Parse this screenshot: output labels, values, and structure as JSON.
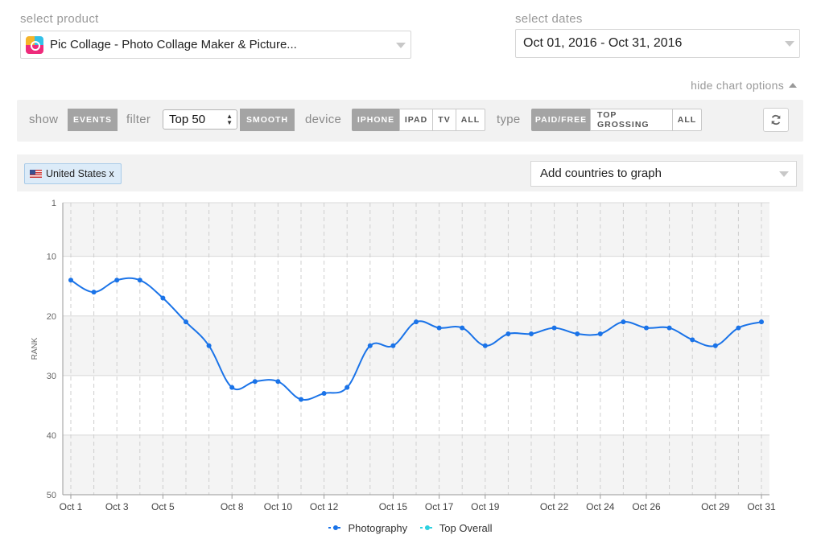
{
  "product": {
    "label": "select product",
    "selected": "Pic Collage - Photo Collage Maker & Picture..."
  },
  "dates": {
    "label": "select dates",
    "selected": "Oct 01, 2016 - Oct 31, 2016"
  },
  "chart_options": {
    "toggle": "hide chart options"
  },
  "options": {
    "show_label": "show",
    "events": "EVENTS",
    "filter_label": "filter",
    "filter_value": "Top 50",
    "smooth": "SMOOTH",
    "device_label": "device",
    "devices": [
      "IPHONE",
      "IPAD",
      "TV",
      "ALL"
    ],
    "type_label": "type",
    "types": [
      "PAID/FREE",
      "TOP GROSSING",
      "ALL"
    ]
  },
  "countries": {
    "selected_chip": "United States x",
    "add_placeholder": "Add countries to graph"
  },
  "colors": {
    "accent": "#1a73e8",
    "top_overall": "#2ed1e0",
    "button_active": "#a4a4a4"
  },
  "chart_data": {
    "type": "line",
    "ylabel": "RANK",
    "xlabel": "",
    "title": "",
    "y_inverted": true,
    "ylim": [
      1,
      50
    ],
    "y_ticks": [
      1,
      10,
      20,
      30,
      40,
      50
    ],
    "x_days": 31,
    "x_tick_labels": [
      {
        "day": 1,
        "label": "Oct 1"
      },
      {
        "day": 3,
        "label": "Oct 3"
      },
      {
        "day": 5,
        "label": "Oct 5"
      },
      {
        "day": 8,
        "label": "Oct 8"
      },
      {
        "day": 10,
        "label": "Oct 10"
      },
      {
        "day": 12,
        "label": "Oct 12"
      },
      {
        "day": 15,
        "label": "Oct 15"
      },
      {
        "day": 17,
        "label": "Oct 17"
      },
      {
        "day": 19,
        "label": "Oct 19"
      },
      {
        "day": 22,
        "label": "Oct 22"
      },
      {
        "day": 24,
        "label": "Oct 24"
      },
      {
        "day": 26,
        "label": "Oct 26"
      },
      {
        "day": 29,
        "label": "Oct 29"
      },
      {
        "day": 31,
        "label": "Oct 31"
      }
    ],
    "grid": true,
    "legend_position": "bottom-center",
    "series": [
      {
        "name": "Photography",
        "values": [
          14,
          16,
          14,
          14,
          17,
          21,
          25,
          32,
          31,
          31,
          34,
          33,
          32,
          25,
          25,
          21,
          22,
          22,
          25,
          23,
          23,
          22,
          23,
          23,
          21,
          22,
          22,
          24,
          25,
          22,
          21
        ]
      },
      {
        "name": "Top Overall",
        "values": []
      }
    ]
  }
}
